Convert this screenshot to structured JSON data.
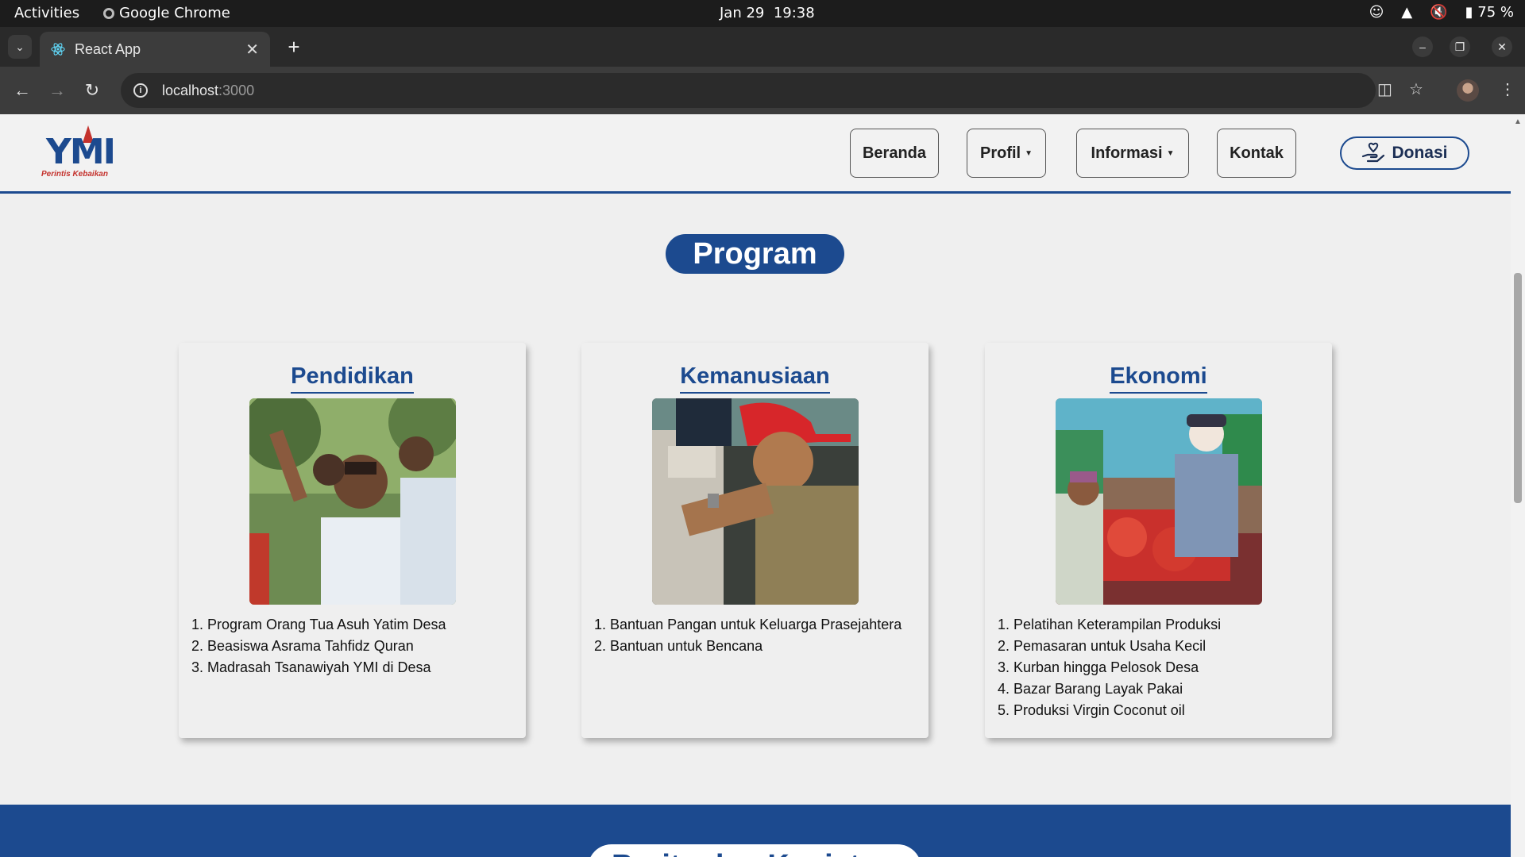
{
  "os": {
    "activities": "Activities",
    "app_name": "Google Chrome",
    "date": "Jan 29",
    "time": "19:38",
    "battery": "75 %"
  },
  "browser": {
    "tab_title": "React App",
    "url_host": "localhost",
    "url_port": ":3000"
  },
  "site": {
    "logo_mark": "YMI",
    "logo_tagline": "Perintis Kebaikan",
    "nav": {
      "beranda": "Beranda",
      "profil": "Profil",
      "informasi": "Informasi",
      "kontak": "Kontak",
      "donasi": "Donasi"
    },
    "section_title": "Program",
    "cards": [
      {
        "title": "Pendidikan",
        "items": [
          "1. Program Orang Tua Asuh Yatim Desa",
          "2. Beasiswa Asrama Tahfidz Quran",
          "3. Madrasah Tsanawiyah YMI di Desa"
        ]
      },
      {
        "title": "Kemanusiaan",
        "items": [
          "1. Bantuan Pangan untuk Keluarga Prasejahtera",
          "2. Bantuan untuk Bencana"
        ]
      },
      {
        "title": "Ekonomi",
        "items": [
          "1. Pelatihan Keterampilan Produksi",
          "2. Pemasaran untuk Usaha Kecil",
          "3. Kurban hingga Pelosok Desa",
          "4. Bazar Barang Layak Pakai",
          "5. Produksi Virgin Coconut oil"
        ]
      }
    ],
    "next_section_title": "Berita dan Kegiatan"
  },
  "colors": {
    "brand_blue": "#1c4a8f",
    "brand_red": "#c4322d"
  }
}
